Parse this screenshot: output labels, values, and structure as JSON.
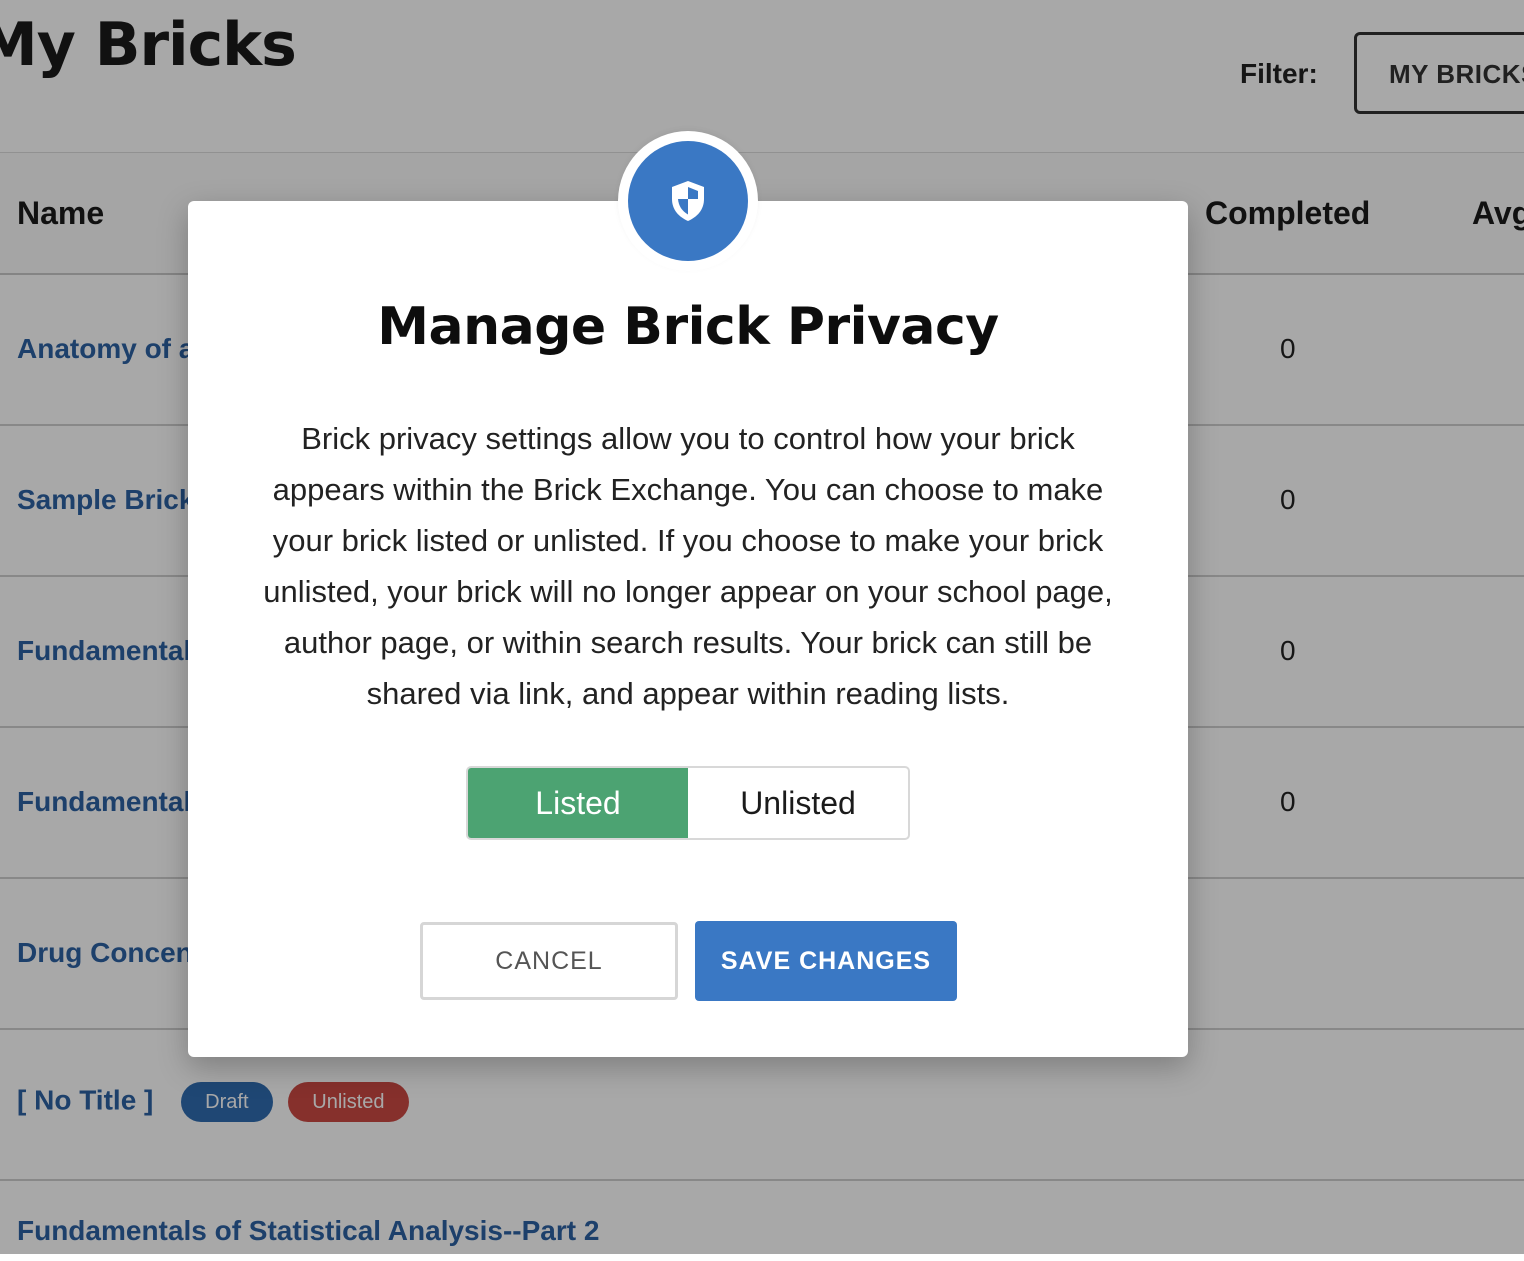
{
  "page": {
    "title": "My Bricks",
    "filter_label": "Filter:",
    "filter_value": "MY BRICKS"
  },
  "table": {
    "columns": {
      "name": "Name",
      "completed": "Completed",
      "avg": "Avg"
    },
    "rows": [
      {
        "name": "Anatomy of a",
        "completed": "0"
      },
      {
        "name": "Sample Brick",
        "completed": "0"
      },
      {
        "name": "Fundamentals",
        "completed": "0"
      },
      {
        "name": "Fundamentals",
        "completed": "0"
      },
      {
        "name": "Drug Concen",
        "completed": ""
      },
      {
        "name": "[ No Title ]",
        "completed": "",
        "badges": [
          "Draft",
          "Unlisted"
        ]
      },
      {
        "name": "Fundamentals of Statistical Analysis--Part 2",
        "completed": ""
      }
    ]
  },
  "modal": {
    "icon": "shield-icon",
    "title": "Manage Brick Privacy",
    "description": "Brick privacy settings allow you to control how your brick appears within the Brick Exchange. You can choose to make your brick listed or unlisted. If you choose to make your brick unlisted, your brick will no longer appear on your school page, author page, or within search results. Your brick can still be shared via link, and appear within reading lists.",
    "toggle": {
      "listed": "Listed",
      "unlisted": "Unlisted",
      "selected": "Listed"
    },
    "cancel_label": "CANCEL",
    "save_label": "SAVE CHANGES"
  },
  "colors": {
    "accent_blue": "#3a78c4",
    "listed_green": "#4ca372",
    "link_blue": "#2d62a3",
    "draft_badge": "#2f6cb0",
    "unlisted_badge": "#cc4a44"
  }
}
